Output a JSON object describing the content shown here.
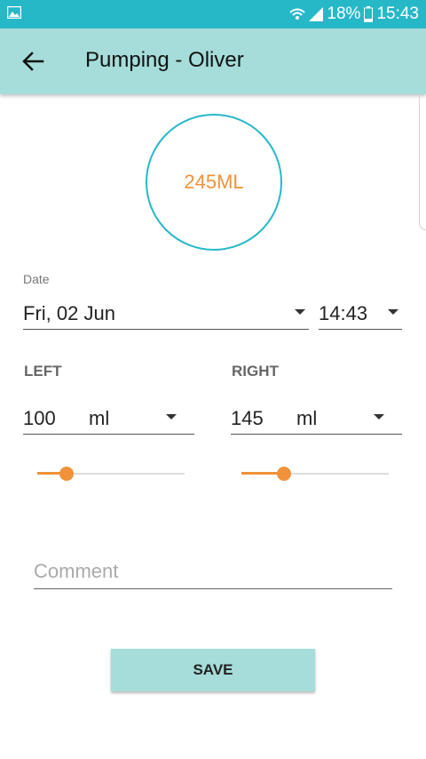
{
  "status_bar": {
    "battery_percent": "18%",
    "time": "15:43",
    "icons": [
      "gallery-icon",
      "wifi-icon",
      "signal-icon",
      "battery-icon"
    ]
  },
  "app_bar": {
    "title": "Pumping - Oliver",
    "back_icon": "arrow-left-icon"
  },
  "total": {
    "label": "245ML"
  },
  "date": {
    "label": "Date",
    "value": "Fri, 02 Jun",
    "time": "14:43"
  },
  "left": {
    "label": "LEFT",
    "amount": "100",
    "unit": "ml",
    "slider_fraction": 0.2
  },
  "right": {
    "label": "RIGHT",
    "amount": "145",
    "unit": "ml",
    "slider_fraction": 0.29
  },
  "comment": {
    "placeholder": "Comment",
    "value": ""
  },
  "save_button": {
    "label": "SAVE"
  },
  "colors": {
    "status_bar": "#27b8c8",
    "app_bar": "#a6dcd9",
    "accent_orange": "#f0923a",
    "circle_border": "#27b8c8"
  }
}
